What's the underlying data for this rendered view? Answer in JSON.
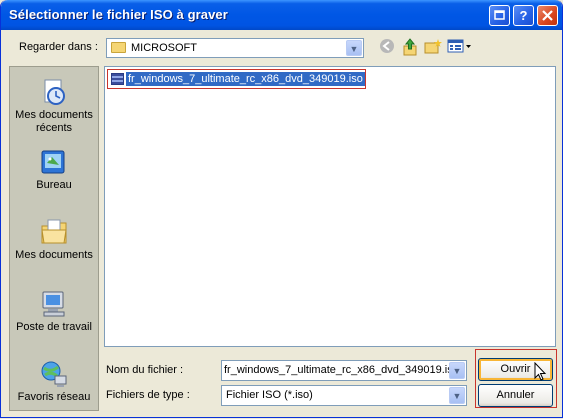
{
  "window": {
    "title": "Sélectionner le fichier ISO à graver"
  },
  "titlebar_buttons": {
    "help": "?",
    "close": "×"
  },
  "look_in": {
    "label": "Regarder dans :",
    "value": "MICROSOFT"
  },
  "toolbar_icons": [
    "back-icon",
    "up-folder-icon",
    "new-folder-icon",
    "view-menu-icon"
  ],
  "places": [
    {
      "label": "Mes documents récents",
      "icon": "recent-documents-icon"
    },
    {
      "label": "Bureau",
      "icon": "desktop-icon"
    },
    {
      "label": "Mes documents",
      "icon": "my-documents-icon"
    },
    {
      "label": "Poste de travail",
      "icon": "my-computer-icon"
    },
    {
      "label": "Favoris réseau",
      "icon": "network-places-icon"
    }
  ],
  "files": [
    {
      "name": "fr_windows_7_ultimate_rc_x86_dvd_349019.iso",
      "icon": "iso-file-icon",
      "selected": true
    }
  ],
  "filename": {
    "label": "Nom du fichier :",
    "value": "fr_windows_7_ultimate_rc_x86_dvd_349019.is"
  },
  "filetype": {
    "label": "Fichiers de type :",
    "value": "Fichier ISO (*.iso)"
  },
  "buttons": {
    "open": "Ouvrir",
    "cancel": "Annuler"
  },
  "colors": {
    "titlebar": "#0054E3",
    "dialog_bg": "#ECE9D8",
    "selection": "#316AC5",
    "highlight_box": "#C9352C"
  }
}
